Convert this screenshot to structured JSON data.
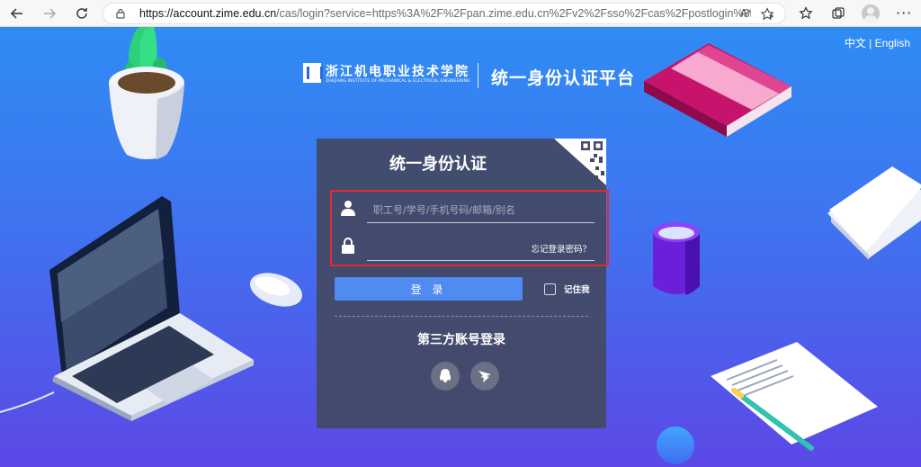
{
  "browser": {
    "url_host": "https://account.zime.edu.cn",
    "url_rest": "/cas/login?service=https%3A%2F%2Fpan.zime.edu.cn%2Fv2%2Fsso%2Fcas%2Fpostlogin%3FstateID%3...",
    "read_aloud": "Aᵃ"
  },
  "lang": {
    "zh": "中文",
    "separator": " | ",
    "en": "English"
  },
  "header": {
    "school_name_cn": "浙江机电职业技术学院",
    "school_name_en": "ZHEJIANG INSTITUTE OF MECHANICAL & ELECTRICAL ENGINEERING",
    "platform_title": "统一身份认证平台"
  },
  "login": {
    "title": "统一身份认证",
    "username_placeholder": "职工号/学号/手机号码/邮箱/别名",
    "password_value": "",
    "forgot_password": "忘记登录密码？",
    "submit_label": "登 录",
    "remember_me": "记住我",
    "third_party_title": "第三方账号登录",
    "third_party": [
      {
        "icon": "qq-icon"
      },
      {
        "icon": "dingtalk-icon"
      }
    ]
  },
  "colors": {
    "page_top": "#2f8cf4",
    "page_bottom": "#5b48e6",
    "card_bg": "#434a68",
    "button": "#4f8bf0",
    "highlight": "#e12b2b"
  }
}
